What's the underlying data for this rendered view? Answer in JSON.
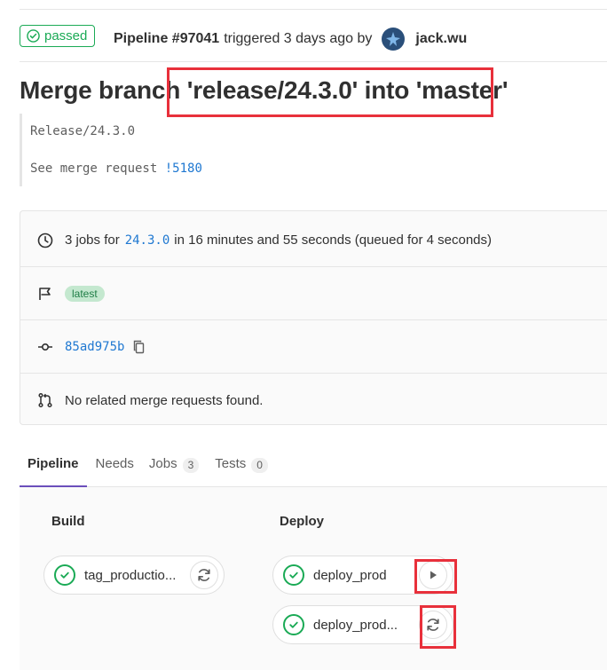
{
  "pipeline": {
    "status": "passed",
    "id_label": "Pipeline #97041",
    "triggered_text": "triggered 3 days ago by",
    "user": "jack.wu"
  },
  "commit": {
    "title": "Merge branch 'release/24.3.0' into 'master'",
    "description_line1": "Release/24.3.0",
    "description_prefix": "See merge request",
    "merge_request_link": "!5180"
  },
  "info": {
    "jobs_prefix": "3 jobs for",
    "ref": "24.3.0",
    "jobs_suffix": "in 16 minutes and 55 seconds (queued for 4 seconds)",
    "badge": "latest",
    "sha": "85ad975b",
    "merge_requests": "No related merge requests found."
  },
  "tabs": {
    "pipeline": "Pipeline",
    "needs": "Needs",
    "jobs": "Jobs",
    "jobs_count": "3",
    "tests": "Tests",
    "tests_count": "0"
  },
  "stages": {
    "build": {
      "title": "Build",
      "jobs": [
        {
          "name": "tag_productio..."
        }
      ]
    },
    "deploy": {
      "title": "Deploy",
      "jobs": [
        {
          "name": "deploy_prod"
        },
        {
          "name": "deploy_prod..."
        }
      ]
    }
  },
  "colors": {
    "success": "#1aaa55",
    "link": "#1f78d1",
    "highlight": "#e8303b",
    "active_tab": "#6b4fbb"
  },
  "icons": [
    "check-circle-icon",
    "clock-icon",
    "flag-icon",
    "commit-icon",
    "copy-icon",
    "merge-request-icon",
    "retry-icon",
    "play-icon"
  ]
}
